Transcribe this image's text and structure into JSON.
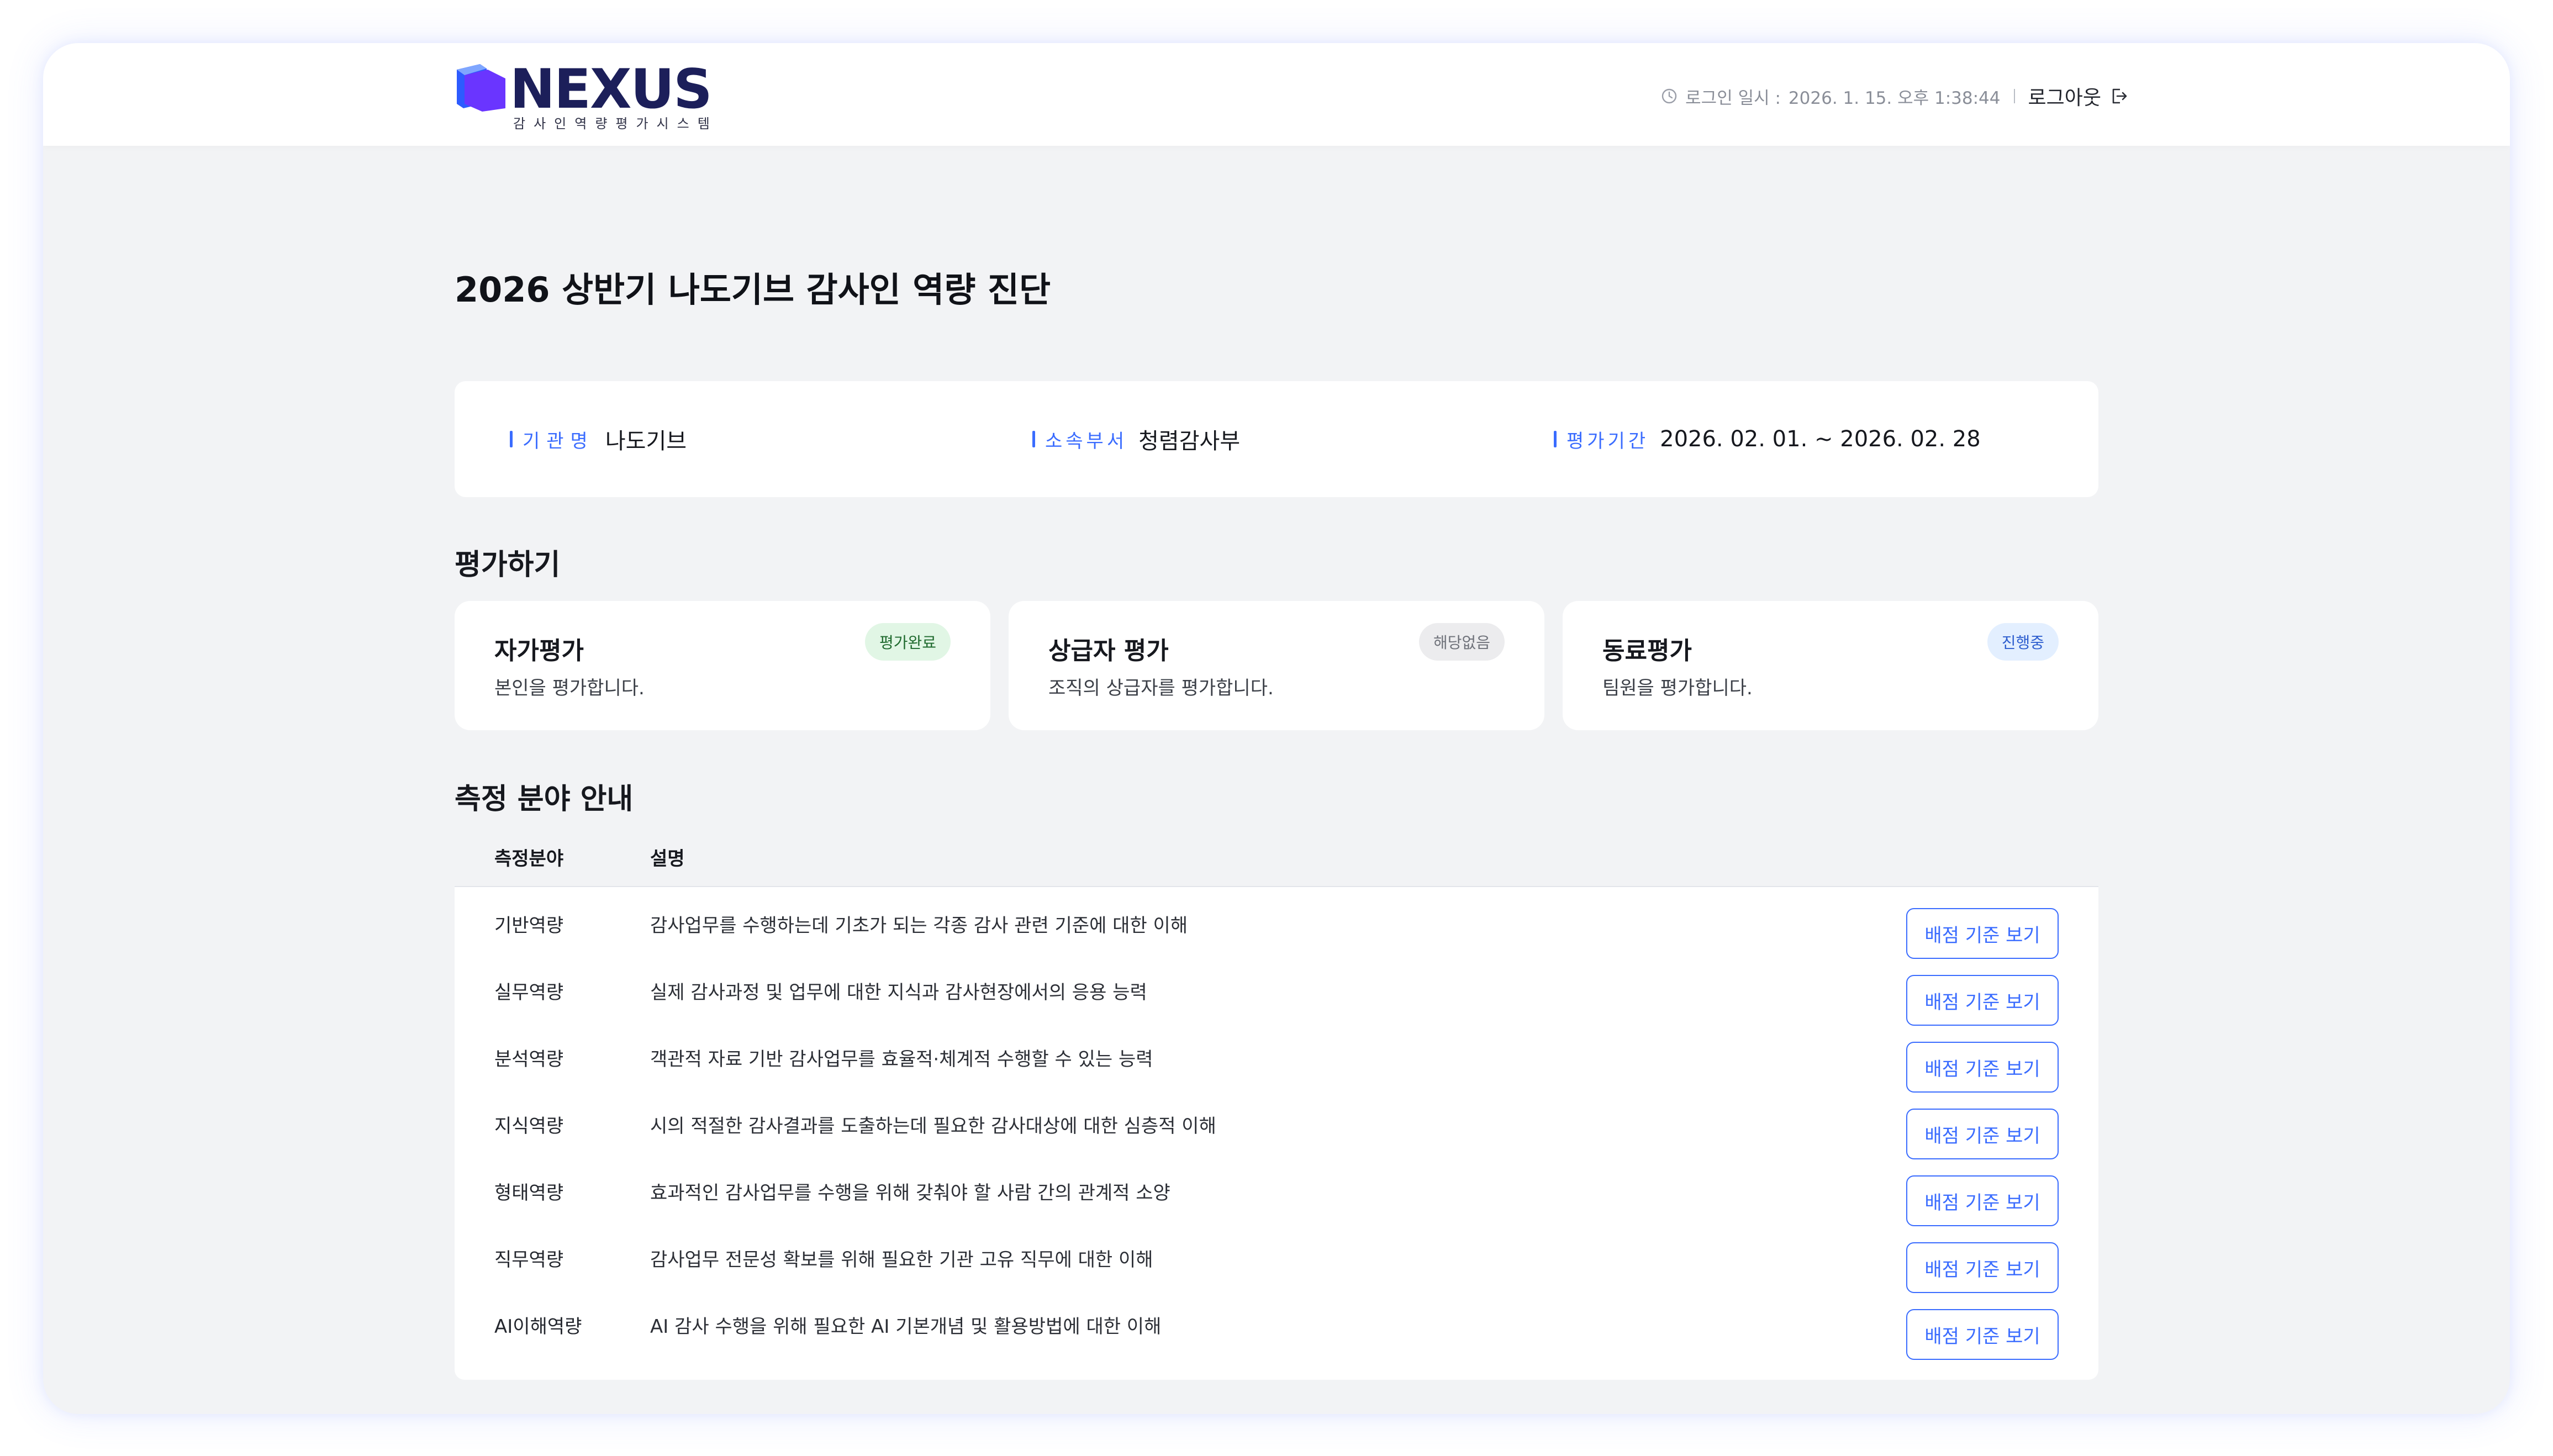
{
  "header": {
    "logo_text": "NEXUS",
    "logo_subtitle": "감사인역량평가시스템",
    "login_label": "로그인 일시 :",
    "login_time": "2026. 1. 15. 오후 1:38:44",
    "logout_label": "로그아웃",
    "colors": {
      "logo_purple": "#6a35ff",
      "logo_blue": "#2d5bff",
      "logo_text": "#1c1f5a"
    }
  },
  "page": {
    "title": "2026 상반기 나도기브 감사인 역량 진단"
  },
  "info": {
    "org_label": "기관명",
    "org_value": "나도기브",
    "dept_label": "소속부서",
    "dept_value": "청렴감사부",
    "period_label": "평가기간",
    "period_value": "2026. 02. 01. ~ 2026. 02. 28"
  },
  "evaluation": {
    "section_title": "평가하기",
    "cards": [
      {
        "name": "자가평가",
        "desc": "본인을 평가합니다.",
        "badge": "평가완료",
        "status": "done"
      },
      {
        "name": "상급자 평가",
        "desc": "조직의 상급자를 평가합니다.",
        "badge": "해당없음",
        "status": "na"
      },
      {
        "name": "동료평가",
        "desc": "팀원을 평가합니다.",
        "badge": "진행중",
        "status": "progress"
      }
    ]
  },
  "areas": {
    "section_title": "측정 분야 안내",
    "col_area": "측정분야",
    "col_desc": "설명",
    "button_label": "배점 기준 보기",
    "rows": [
      {
        "area": "기반역량",
        "desc": "감사업무를 수행하는데 기초가 되는 각종 감사 관련 기준에 대한 이해"
      },
      {
        "area": "실무역량",
        "desc": "실제 감사과정 및 업무에 대한 지식과 감사현장에서의 응용 능력"
      },
      {
        "area": "분석역량",
        "desc": "객관적 자료 기반 감사업무를 효율적·체계적 수행할 수 있는 능력"
      },
      {
        "area": "지식역량",
        "desc": "시의 적절한 감사결과를 도출하는데 필요한 감사대상에 대한 심층적 이해"
      },
      {
        "area": "형태역량",
        "desc": "효과적인 감사업무를 수행을 위해 갖춰야 할 사람 간의 관계적 소양"
      },
      {
        "area": "직무역량",
        "desc": "감사업무 전문성 확보를 위해 필요한 기관 고유 직무에 대한 이해"
      },
      {
        "area": "AI이해역량",
        "desc": "AI 감사 수행을 위해 필요한 AI 기본개념 및 활용방법에 대한 이해"
      }
    ]
  }
}
